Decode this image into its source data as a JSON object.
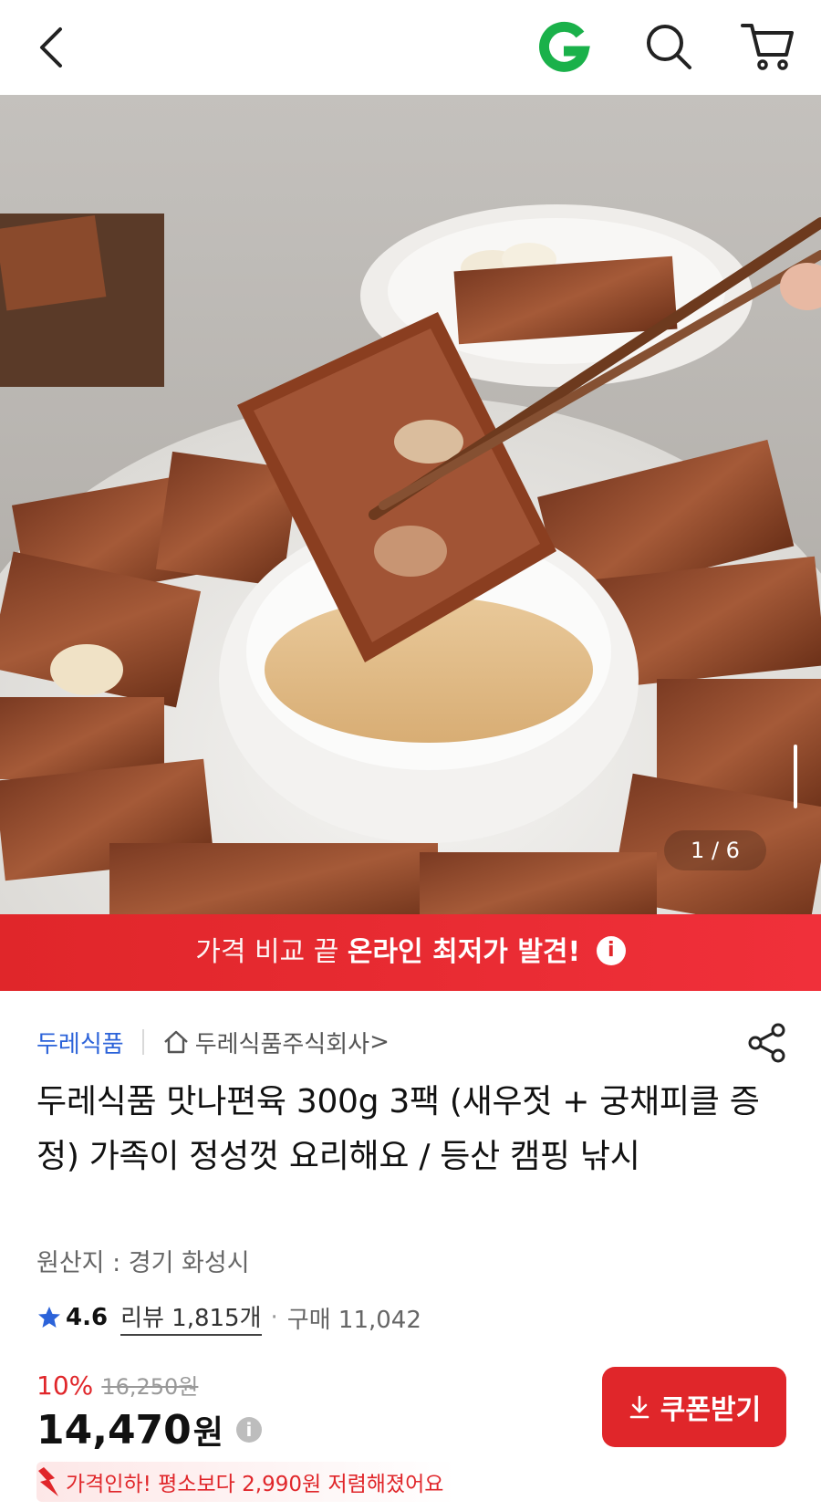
{
  "header": {
    "back_icon": "chevron-left-icon",
    "logo_icon": "g-logo-icon",
    "search_icon": "search-icon",
    "cart_icon": "cart-icon",
    "logo_color": "#1ab14a"
  },
  "gallery": {
    "counter": "1 / 6"
  },
  "banner": {
    "text_light": "가격 비교 끝",
    "text_bold": "온라인 최저가 발견!",
    "info": "i",
    "color": "#e0262a"
  },
  "seller": {
    "brand": "두레식품",
    "store": "두레식품주식회사",
    "store_chevron": ">",
    "share_icon": "share-icon"
  },
  "product": {
    "title": "두레식품 맛나편육 300g 3팩 (새우젓 + 궁채피클 증정) 가족이 정성껏 요리해요 / 등산 캠핑 낚시",
    "origin": "원산지 : 경기 화성시",
    "rating": "4.6",
    "reviews": "리뷰 1,815개",
    "separator": "·",
    "purchases": "구매 11,042"
  },
  "price": {
    "discount": "10%",
    "original": "16,250원",
    "current": "14,470",
    "currency": "원",
    "info": "i",
    "coupon_label": "쿠폰받기",
    "drop_text": "가격인하! 평소보다 2,990원 저렴해졌어요",
    "accent": "#e0262a"
  }
}
